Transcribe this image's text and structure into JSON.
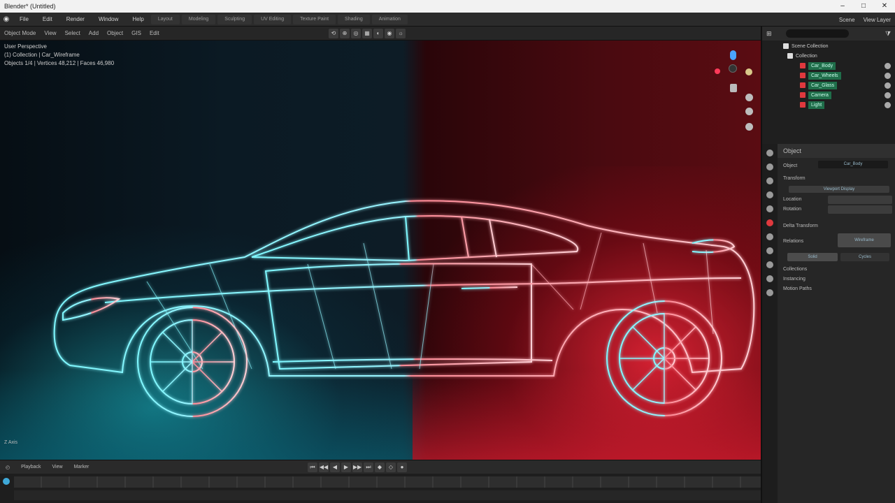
{
  "window": {
    "title": "Blender* (Untitled)",
    "controls": [
      "–",
      "□",
      "✕"
    ]
  },
  "menubar": {
    "items": [
      "File",
      "Edit",
      "Render",
      "Window",
      "Help"
    ],
    "workspaces": [
      "Layout",
      "Modeling",
      "Sculpting",
      "UV Editing",
      "Texture Paint",
      "Shading",
      "Animation"
    ],
    "right": [
      "Scene",
      "View Layer"
    ]
  },
  "header": {
    "items": [
      "Object Mode",
      "View",
      "Select",
      "Add",
      "Object",
      "GIS",
      "Edit"
    ],
    "center_tools": [
      "⟲",
      "⊕",
      "◎",
      "▦",
      "◐",
      "◉",
      "☼"
    ]
  },
  "viewport": {
    "stats": [
      "User Perspective",
      "(1) Collection | Car_Wireframe",
      "Objects 1/4 | Vertices 48,212 | Faces 46,980"
    ],
    "bottom_label": "Z Axis"
  },
  "timeline": {
    "items": [
      "Playback",
      "View",
      "Marker"
    ],
    "play_controls": [
      "⏮",
      "◀◀",
      "◀",
      "▶",
      "▶▶",
      "⏭",
      "◆",
      "◇",
      "●"
    ]
  },
  "outliner": {
    "rows": [
      {
        "name": "Scene Collection"
      },
      {
        "name": "Collection"
      },
      {
        "name": "Car_Body"
      },
      {
        "name": "Car_Wheels"
      },
      {
        "name": "Car_Glass"
      },
      {
        "name": "Camera"
      },
      {
        "name": "Light"
      }
    ]
  },
  "properties": {
    "title": "Object",
    "rows": [
      "Object",
      "Transform",
      "Location",
      "Rotation",
      "Delta Transform",
      "Relations",
      "Collections",
      "Instancing",
      "Motion Paths"
    ],
    "fields": [
      "Car_Body",
      "Viewport Display",
      "Wireframe",
      "Solid",
      "Cycles"
    ]
  },
  "colors": {
    "teal": "#4ff0ff",
    "red": "#ff3a4a",
    "panel": "#262626"
  },
  "icons": [
    "blender-logo-icon",
    "search-icon",
    "eye-icon",
    "camera-icon",
    "light-icon",
    "mesh-icon"
  ]
}
